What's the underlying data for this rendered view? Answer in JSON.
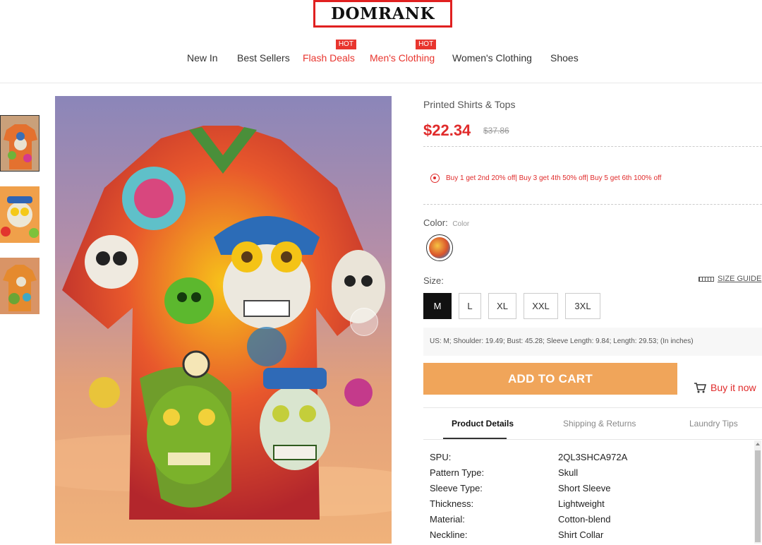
{
  "brand": {
    "logo": "DOMRANK"
  },
  "nav": {
    "items": [
      {
        "label": "New In",
        "hot": false
      },
      {
        "label": "Best Sellers",
        "hot": false
      },
      {
        "label": "Flash Deals",
        "hot": true
      },
      {
        "label": "Men's Clothing",
        "hot": true
      },
      {
        "label": "Women's Clothing",
        "hot": false
      },
      {
        "label": "Shoes",
        "hot": false
      }
    ],
    "hot_badge": "HOT"
  },
  "product": {
    "category": "Printed Shirts & Tops",
    "price": "$22.34",
    "old_price": "$37.86",
    "promo": "Buy 1 get 2nd 20% off| Buy 3 get 4th 50% off| Buy 5 get 6th 100% off",
    "color_label": "Color:",
    "color_value": "Color",
    "size_label": "Size:",
    "size_guide": "SIZE GUIDE",
    "sizes": [
      "M",
      "L",
      "XL",
      "XXL",
      "3XL"
    ],
    "selected_size": "M",
    "measurements": "US: M;  Shoulder: 19.49;  Bust: 45.28;  Sleeve Length: 9.84;  Length: 29.53;  (In inches)",
    "add_to_cart": "ADD TO CART",
    "buy_now": "Buy it now"
  },
  "tabs": [
    "Product Details",
    "Shipping & Returns",
    "Laundry Tips"
  ],
  "details": [
    {
      "key": "SPU:",
      "value": "2QL3SHCA972A"
    },
    {
      "key": "Pattern Type:",
      "value": "Skull"
    },
    {
      "key": "Sleeve Type:",
      "value": "Short Sleeve"
    },
    {
      "key": "Thickness:",
      "value": "Lightweight"
    },
    {
      "key": "Material:",
      "value": "Cotton-blend"
    },
    {
      "key": "Neckline:",
      "value": "Shirt Collar"
    }
  ],
  "colors": {
    "accent": "#e02b2b",
    "cart": "#f0a55a",
    "logo_border": "#e02020"
  }
}
